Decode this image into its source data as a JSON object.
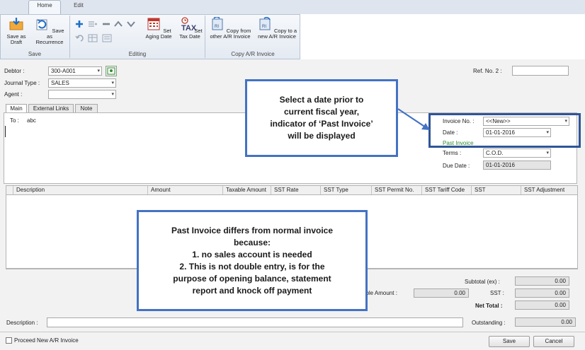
{
  "ribbon": {
    "tab_home": "Home",
    "tab_edit": "Edit",
    "buttons": {
      "save_draft": "Save as Draft",
      "save_recurrence": "Save as Recurrence",
      "set_aging_date": "Set Aging Date",
      "set_tax_date": "Set Tax Date",
      "copy_from_other": "Copy from other A/R Invoice",
      "copy_to_new": "Copy to a new A/R Invoice"
    },
    "groups": {
      "save": "Save",
      "editing": "Editing",
      "copy": "Copy A/R Invoice"
    },
    "tax_icon_text": "TAX"
  },
  "header": {
    "debtor_label": "Debtor :",
    "debtor_value": "300-A001",
    "journal_type_label": "Journal Type :",
    "journal_type_value": "SALES",
    "agent_label": "Agent :",
    "agent_value": "",
    "ref_no2_label": "Ref. No. 2 :",
    "ref_no2_value": ""
  },
  "tabs": [
    "Main",
    "External Links",
    "Note"
  ],
  "main": {
    "to_label": "To :",
    "to_value": "abc"
  },
  "invoice": {
    "invoice_no_label": "Invoice No. :",
    "invoice_no_value": "<<New>>",
    "date_label": "Date :",
    "date_value": "01-01-2016",
    "past_invoice": "Past Invoice",
    "terms_label": "Terms :",
    "terms_value": "C.O.D.",
    "due_date_label": "Due Date :",
    "due_date_value": "01-01-2016"
  },
  "grid": {
    "columns": [
      "Description",
      "Amount",
      "Taxable Amount",
      "SST Rate",
      "SST Type",
      "SST Permit No.",
      "SST Tariff Code",
      "SST",
      "SST Adjustment"
    ]
  },
  "totals": {
    "taxable_amount_label": "able Amount :",
    "taxable_amount_value": "0.00",
    "subtotal_label": "Subtotal (ex) :",
    "subtotal_value": "0.00",
    "sst_label": "SST :",
    "sst_value": "0.00",
    "net_total_label": "Net Total :",
    "net_total_value": "0.00",
    "outstanding_label": "Outstanding :",
    "outstanding_value": "0.00"
  },
  "footer": {
    "description_label": "Description :",
    "description_value": "",
    "proceed_new_label": "Proceed New A/R Invoice",
    "save_button": "Save",
    "cancel_button": "Cancel"
  },
  "callouts": {
    "date_note_lines": [
      "Select a date prior to",
      "current fiscal year,",
      "indicator of ‘Past Invoice’",
      "will be displayed"
    ],
    "past_invoice_lines": [
      "Past Invoice differs from normal invoice",
      "because:",
      "1. no sales account is needed",
      "2. This is not double entry, is for the",
      "purpose of opening balance, statement",
      "report and knock off payment"
    ]
  },
  "colors": {
    "callout_border": "#4472c4",
    "past_invoice_text": "#2e8b2e",
    "ribbon_bg": "#e4eaf2"
  },
  "icons": [
    "save-draft-icon",
    "recurrence-icon",
    "add-icon",
    "aging-calendar-icon",
    "tax-clock-icon",
    "copy-from-icon",
    "copy-to-icon",
    "debtor-lookup-icon",
    "dropdown-icon",
    "checkbox-icon"
  ]
}
